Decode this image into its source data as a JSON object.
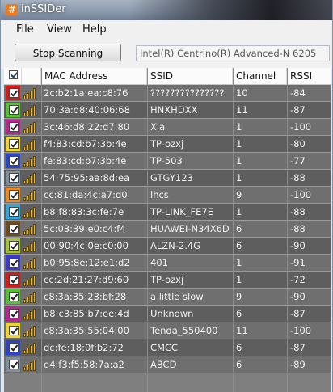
{
  "window": {
    "title": "inSSIDer",
    "icon": "hash-app-icon"
  },
  "menu": [
    {
      "label": "File"
    },
    {
      "label": "View"
    },
    {
      "label": "Help"
    }
  ],
  "toolbar": {
    "scan_button": "Stop Scanning",
    "adapter": "Intel(R) Centrino(R) Advanced-N 6205"
  },
  "columns": {
    "mac": "MAC Address",
    "ssid": "SSID",
    "channel": "Channel",
    "rssi": "RSSI"
  },
  "rows": [
    {
      "color": "#d01c1c",
      "mac": "2c:b2:1a:ea:c8:76",
      "ssid": "???????????????",
      "channel": "10",
      "rssi": "-84",
      "signal": 4
    },
    {
      "color": "#55c233",
      "mac": "70:3a:d8:40:06:68",
      "ssid": "HNXHDXX",
      "channel": "11",
      "rssi": "-87",
      "signal": 4
    },
    {
      "color": "#b6268f",
      "mac": "3c:46:d8:22:d7:80",
      "ssid": "Xia",
      "channel": "1",
      "rssi": "-100",
      "signal": 4
    },
    {
      "color": "#f2d625",
      "mac": "f4:83:cd:b7:3b:4e",
      "ssid": "TP-ozxj",
      "channel": "1",
      "rssi": "-80",
      "signal": 4
    },
    {
      "color": "#2c43c4",
      "mac": "fe:83:cd:b7:3b:4e",
      "ssid": "TP-503",
      "channel": "1",
      "rssi": "-77",
      "signal": 4
    },
    {
      "color": "#7f8f9d",
      "mac": "54:75:95:aa:8d:ea",
      "ssid": "GTGY123",
      "channel": "1",
      "rssi": "-88",
      "signal": 4
    },
    {
      "color": "#ec8a1a",
      "mac": "cc:81:da:4c:a7:d0",
      "ssid": "lhcs",
      "channel": "9",
      "rssi": "-100",
      "signal": 4
    },
    {
      "color": "#34a7d8",
      "mac": "b8:f8:83:3c:fe:7e",
      "ssid": "TP-LINK_FE7E",
      "channel": "1",
      "rssi": "-88",
      "signal": 4
    },
    {
      "color": "#6e4a1e",
      "mac": "5c:03:39:e0:c4:f4",
      "ssid": "HUAWEI-N34X6D",
      "channel": "6",
      "rssi": "-88",
      "signal": 4
    },
    {
      "color": "#a6c535",
      "mac": "00:90:4c:0e:c0:00",
      "ssid": "ALZN-2.4G",
      "channel": "6",
      "rssi": "-90",
      "signal": 4
    },
    {
      "color": "#3a3ad0",
      "mac": "b0:95:8e:12:e1:d2",
      "ssid": "401",
      "channel": "1",
      "rssi": "-91",
      "signal": 4
    },
    {
      "color": "#d01c1c",
      "mac": "cc:2d:21:27:d9:60",
      "ssid": "TP-ozxj",
      "channel": "1",
      "rssi": "-72",
      "signal": 4
    },
    {
      "color": "#55c233",
      "mac": "c8:3a:35:23:bf:28",
      "ssid": "a little slow",
      "channel": "9",
      "rssi": "-90",
      "signal": 4
    },
    {
      "color": "#b6268f",
      "mac": "b8:c3:85:b7:ee:4d",
      "ssid": "Unknown",
      "channel": "6",
      "rssi": "-87",
      "signal": 4
    },
    {
      "color": "#f2d625",
      "mac": "c8:3a:35:55:04:00",
      "ssid": "Tenda_550400",
      "channel": "11",
      "rssi": "-100",
      "signal": 4
    },
    {
      "color": "#2c43c4",
      "mac": "dc:fe:18:0f:b2:72",
      "ssid": "CMCC",
      "channel": "6",
      "rssi": "-87",
      "signal": 4
    },
    {
      "color": "#7f8f9d",
      "mac": "e4:f3:f5:58:7a:a2",
      "ssid": "ABCD",
      "channel": "6",
      "rssi": "-89",
      "signal": 4
    }
  ]
}
